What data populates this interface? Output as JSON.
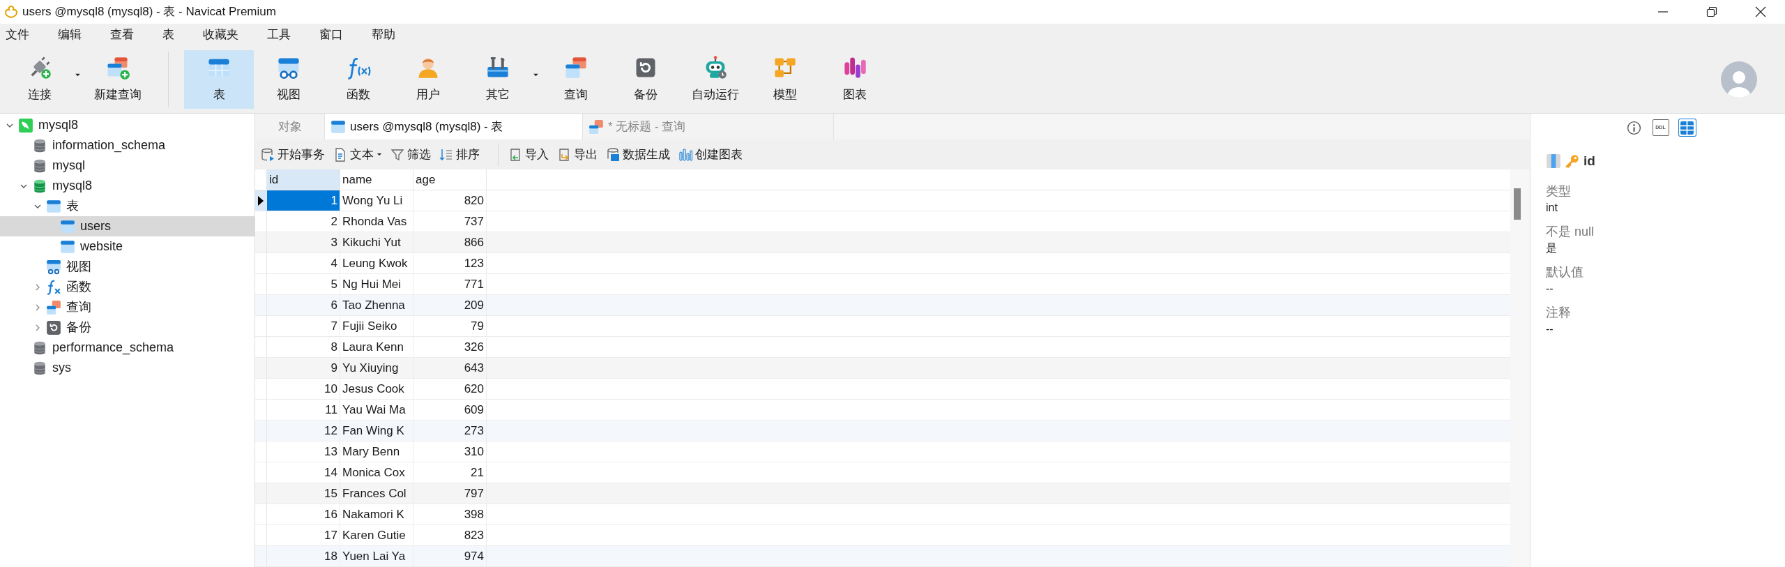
{
  "window": {
    "title": "users @mysql8 (mysql8) - 表 - Navicat Premium"
  },
  "menu": [
    "文件",
    "编辑",
    "查看",
    "表",
    "收藏夹",
    "工具",
    "窗口",
    "帮助"
  ],
  "toolbar": [
    [
      {
        "kind": "connect",
        "label": "连接",
        "selected": false,
        "dropdown": true
      },
      {
        "kind": "new-query",
        "label": "新建查询",
        "selected": false,
        "dropdown": false
      }
    ],
    [
      {
        "kind": "table",
        "label": "表",
        "selected": true,
        "dropdown": false
      },
      {
        "kind": "view",
        "label": "视图",
        "selected": false,
        "dropdown": false
      },
      {
        "kind": "function",
        "label": "函数",
        "selected": false,
        "dropdown": false
      },
      {
        "kind": "user",
        "label": "用户",
        "selected": false,
        "dropdown": false
      },
      {
        "kind": "other",
        "label": "其它",
        "selected": false,
        "dropdown": true
      },
      {
        "kind": "query",
        "label": "查询",
        "selected": false,
        "dropdown": false
      },
      {
        "kind": "backup",
        "label": "备份",
        "selected": false,
        "dropdown": false
      },
      {
        "kind": "automation",
        "label": "自动运行",
        "selected": false,
        "dropdown": false
      },
      {
        "kind": "model",
        "label": "模型",
        "selected": false,
        "dropdown": false
      },
      {
        "kind": "chart",
        "label": "图表",
        "selected": false,
        "dropdown": false
      }
    ]
  ],
  "sidebar": {
    "tree": [
      {
        "kind": "connection",
        "label": "mysql8",
        "expanded": true,
        "selected": false,
        "children": [
          {
            "kind": "database",
            "label": "information_schema",
            "selected": false
          },
          {
            "kind": "database",
            "label": "mysql",
            "selected": false
          },
          {
            "kind": "database-open",
            "label": "mysql8",
            "expanded": true,
            "selected": false,
            "children": [
              {
                "kind": "tables",
                "label": "表",
                "expanded": true,
                "selected": false,
                "children": [
                  {
                    "kind": "table",
                    "label": "users",
                    "selected": true
                  },
                  {
                    "kind": "table",
                    "label": "website",
                    "selected": false
                  }
                ]
              },
              {
                "kind": "views",
                "label": "视图",
                "selected": false
              },
              {
                "kind": "functions",
                "label": "函数",
                "expanded": false,
                "selected": false
              },
              {
                "kind": "queries",
                "label": "查询",
                "expanded": false,
                "selected": false
              },
              {
                "kind": "backups",
                "label": "备份",
                "expanded": false,
                "selected": false
              }
            ]
          },
          {
            "kind": "database",
            "label": "performance_schema",
            "selected": false
          },
          {
            "kind": "database",
            "label": "sys",
            "selected": false
          }
        ]
      }
    ]
  },
  "tabs": [
    {
      "kind": "objects",
      "label": "对象",
      "selected": false
    },
    {
      "kind": "table",
      "label": "users @mysql8 (mysql8) - 表",
      "selected": true
    },
    {
      "kind": "query",
      "label": "* 无标题 - 查询",
      "selected": false
    }
  ],
  "grid_toolbar": [
    [
      {
        "kind": "transaction",
        "label": "开始事务",
        "dropdown": false
      },
      {
        "kind": "text",
        "label": "文本",
        "dropdown": true
      },
      {
        "kind": "filter",
        "label": "筛选",
        "dropdown": false
      },
      {
        "kind": "sort",
        "label": "排序",
        "dropdown": false
      }
    ],
    [
      {
        "kind": "import",
        "label": "导入",
        "dropdown": false
      },
      {
        "kind": "export",
        "label": "导出",
        "dropdown": false
      },
      {
        "kind": "generate",
        "label": "数据生成",
        "dropdown": false
      },
      {
        "kind": "chart",
        "label": "创建图表",
        "dropdown": false
      }
    ]
  ],
  "table": {
    "columns": [
      {
        "label": "id",
        "selected": true,
        "kind": "number"
      },
      {
        "label": "name",
        "selected": false,
        "kind": "text"
      },
      {
        "label": "age",
        "selected": false,
        "kind": "number"
      }
    ],
    "rows": [
      {
        "cells": [
          "1",
          "Wong Yu Li",
          "820"
        ],
        "selected": true
      },
      {
        "cells": [
          "2",
          "Rhonda Vas",
          "737"
        ],
        "selected": false
      },
      {
        "cells": [
          "3",
          "Kikuchi Yut",
          "866"
        ],
        "selected": false
      },
      {
        "cells": [
          "4",
          "Leung Kwok",
          "123"
        ],
        "selected": false
      },
      {
        "cells": [
          "5",
          "Ng Hui Mei",
          "771"
        ],
        "selected": false
      },
      {
        "cells": [
          "6",
          "Tao Zhenna",
          "209"
        ],
        "selected": false
      },
      {
        "cells": [
          "7",
          "Fujii Seiko",
          "79"
        ],
        "selected": false
      },
      {
        "cells": [
          "8",
          "Laura Kenn",
          "326"
        ],
        "selected": false
      },
      {
        "cells": [
          "9",
          "Yu Xiuying",
          "643"
        ],
        "selected": false
      },
      {
        "cells": [
          "10",
          "Jesus Cook",
          "620"
        ],
        "selected": false
      },
      {
        "cells": [
          "11",
          "Yau Wai Ma",
          "609"
        ],
        "selected": false
      },
      {
        "cells": [
          "12",
          "Fan Wing K",
          "273"
        ],
        "selected": false
      },
      {
        "cells": [
          "13",
          "Mary Benn",
          "310"
        ],
        "selected": false
      },
      {
        "cells": [
          "14",
          "Monica Cox",
          "21"
        ],
        "selected": false
      },
      {
        "cells": [
          "15",
          "Frances Col",
          "797"
        ],
        "selected": false
      },
      {
        "cells": [
          "16",
          "Nakamori K",
          "398"
        ],
        "selected": false
      },
      {
        "cells": [
          "17",
          "Karen Gutie",
          "823"
        ],
        "selected": false
      },
      {
        "cells": [
          "18",
          "Yuen Lai Ya",
          "974"
        ],
        "selected": false
      }
    ]
  },
  "field_panel": {
    "tabs": [
      {
        "kind": "info",
        "selected": false
      },
      {
        "kind": "ddl",
        "label": "DDL",
        "selected": false
      },
      {
        "kind": "fields",
        "selected": true
      }
    ],
    "field": "id",
    "primary_key": true,
    "properties": [
      {
        "label": "类型",
        "value": "int"
      },
      {
        "label": "不是 null",
        "value": "是"
      },
      {
        "label": "默认值",
        "value": "--"
      },
      {
        "label": "注释",
        "value": "--"
      }
    ]
  }
}
